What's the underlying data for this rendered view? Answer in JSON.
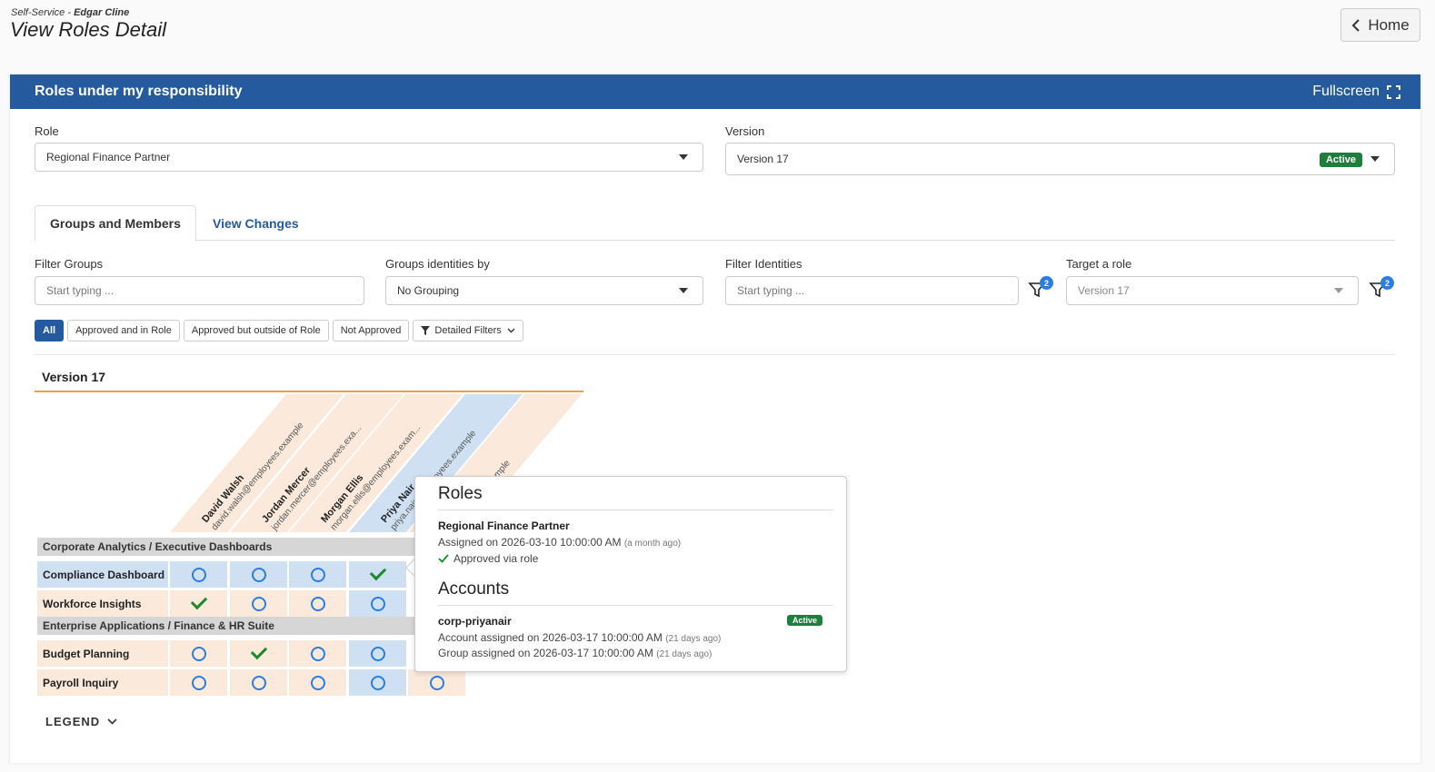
{
  "header": {
    "breadcrumb_prefix": "Self-Service -",
    "breadcrumb_user": "Edgar Cline",
    "title": "View Roles Detail",
    "home_label": "Home"
  },
  "card": {
    "title": "Roles under my responsibility",
    "fullscreen_label": "Fullscreen"
  },
  "role": {
    "label": "Role",
    "value": "Regional Finance Partner"
  },
  "version": {
    "label": "Version",
    "value": "Version 17",
    "badge": "Active"
  },
  "tabs": [
    {
      "label": "Groups and Members",
      "active": true
    },
    {
      "label": "View Changes",
      "active": false
    }
  ],
  "filters": {
    "filter_groups_label": "Filter Groups",
    "filter_groups_placeholder": "Start typing ...",
    "group_by_label": "Groups identities by",
    "group_by_value": "No Grouping",
    "filter_identities_label": "Filter Identities",
    "filter_identities_placeholder": "Start typing ...",
    "identities_filter_count": "2",
    "target_role_label": "Target a role",
    "target_role_value": "Version 17",
    "target_filter_count": "2"
  },
  "chips": [
    "All",
    "Approved and in Role",
    "Approved but outside of Role",
    "Not Approved",
    "Detailed Filters"
  ],
  "matrix": {
    "version_title": "Version 17",
    "identities": [
      {
        "name": "David Walsh",
        "email": "david.walsh@employees.example",
        "highlight": false
      },
      {
        "name": "Jordan Mercer",
        "email": "jordan.mercer@employees.exa...",
        "highlight": false
      },
      {
        "name": "Morgan Ellis",
        "email": "morgan.ellis@employees.exam...",
        "highlight": false
      },
      {
        "name": "Priya Nair",
        "email": "priya.nair@employees.example",
        "highlight": true
      },
      {
        "name": "",
        "email": "...employees.example",
        "highlight": false
      }
    ],
    "groups": [
      {
        "title": "Corporate Analytics / Executive Dashboards",
        "rows": [
          {
            "label": "Compliance Dashboard",
            "highlight": true,
            "cells": [
              "circle",
              "circle",
              "circle",
              "check",
              "hidden"
            ]
          },
          {
            "label": "Workforce Insights",
            "highlight": false,
            "cells": [
              "check",
              "circle",
              "circle",
              "circle",
              "hidden"
            ]
          }
        ]
      },
      {
        "title": "Enterprise Applications / Finance & HR Suite",
        "rows": [
          {
            "label": "Budget Planning",
            "highlight": false,
            "cells": [
              "circle",
              "check",
              "circle",
              "circle",
              "hidden"
            ]
          },
          {
            "label": "Payroll Inquiry",
            "highlight": false,
            "cells": [
              "circle",
              "circle",
              "circle",
              "circle",
              "circle"
            ]
          }
        ]
      }
    ],
    "legend_label": "LEGEND"
  },
  "popup": {
    "roles_heading": "Roles",
    "role_name": "Regional Finance Partner",
    "role_assigned": "Assigned on 2026-03-10 10:00:00 AM",
    "role_assigned_rel": "(a month ago)",
    "role_status": "Approved via role",
    "accounts_heading": "Accounts",
    "account_name": "corp-priyanair",
    "account_badge": "Active",
    "account_assigned": "Account assigned on 2026-03-17 10:00:00 AM",
    "account_assigned_rel": "(21 days ago)",
    "group_assigned": "Group assigned on 2026-03-17 10:00:00 AM",
    "group_assigned_rel": "(21 days ago)"
  },
  "colors": {
    "primary": "#255b9e",
    "peach": "#fbeadb",
    "highlight_blue": "#cfe0f3",
    "active_green": "#1e7e3c"
  }
}
